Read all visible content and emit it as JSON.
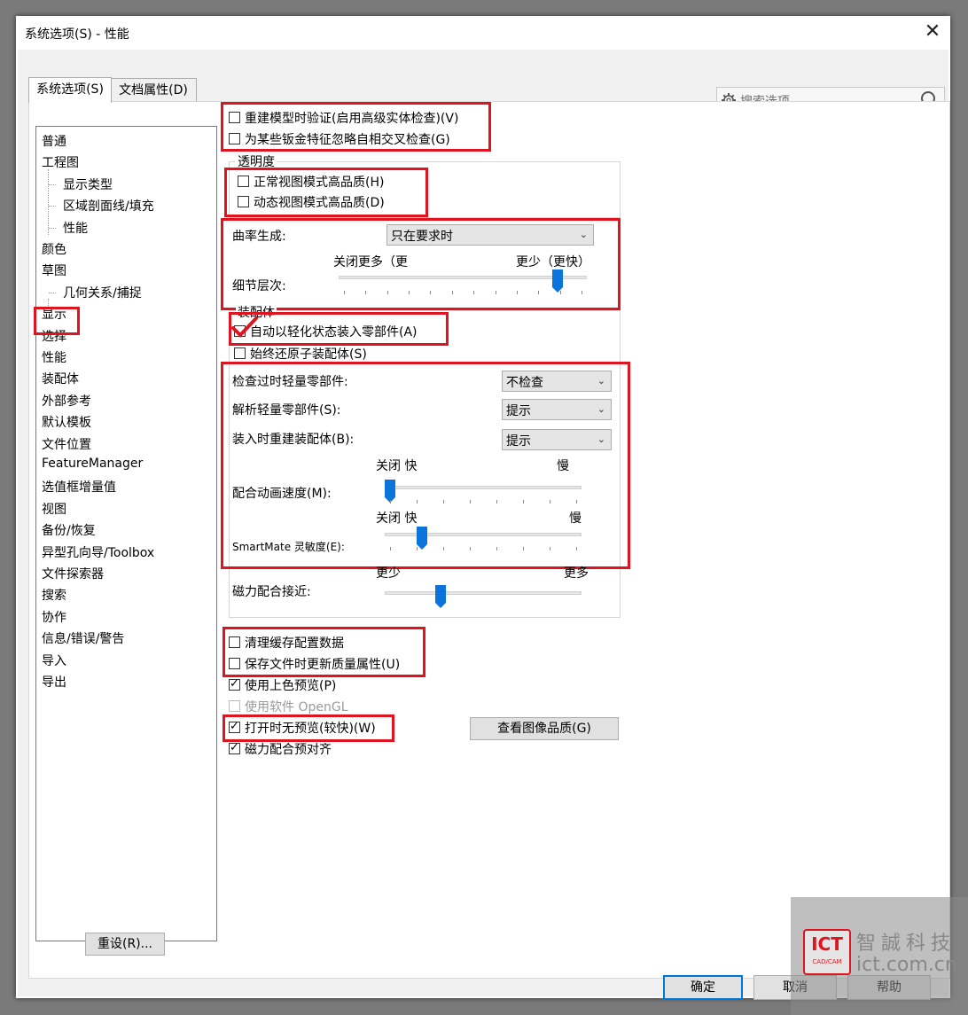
{
  "window": {
    "title": "系统选项(S) - 性能",
    "close": "✕"
  },
  "tabs": [
    {
      "label": "系统选项(S)",
      "active": true
    },
    {
      "label": "文档属性(D)",
      "active": false
    }
  ],
  "search": {
    "placeholder": "搜索选项",
    "icon": "gear-icon",
    "search_icon": "magnifier-icon"
  },
  "tree": [
    {
      "label": "普通"
    },
    {
      "label": "工程图"
    },
    {
      "label": "显示类型",
      "child": true
    },
    {
      "label": "区域剖面线/填充",
      "child": true
    },
    {
      "label": "性能",
      "child": true
    },
    {
      "label": "颜色"
    },
    {
      "label": "草图"
    },
    {
      "label": "几何关系/捕捉",
      "child": true
    },
    {
      "label": "显示"
    },
    {
      "label": "选择"
    },
    {
      "label": "性能",
      "selected": true
    },
    {
      "label": "装配体"
    },
    {
      "label": "外部参考"
    },
    {
      "label": "默认模板"
    },
    {
      "label": "文件位置"
    },
    {
      "label": "FeatureManager"
    },
    {
      "label": "选值框增量值"
    },
    {
      "label": "视图"
    },
    {
      "label": "备份/恢复"
    },
    {
      "label": "异型孔向导/Toolbox"
    },
    {
      "label": "文件探索器"
    },
    {
      "label": "搜索"
    },
    {
      "label": "协作"
    },
    {
      "label": "信息/错误/警告"
    },
    {
      "label": "导入"
    },
    {
      "label": "导出"
    }
  ],
  "top_checks": [
    {
      "label": "重建模型时验证(启用高级实体检查)(V)",
      "checked": false
    },
    {
      "label": "为某些钣金特征忽略自相交叉检查(G)",
      "checked": false
    }
  ],
  "transparency": {
    "legend": "透明度",
    "checks": [
      {
        "label": "正常视图模式高品质(H)",
        "checked": false
      },
      {
        "label": "动态视图模式高品质(D)",
        "checked": false
      }
    ]
  },
  "curvature": {
    "label": "曲率生成:",
    "value": "只在要求时",
    "detail_label": "细节层次:",
    "left_caption": "关闭更多（更",
    "right_caption": "更少（更快）",
    "level": 0.9
  },
  "assembly": {
    "legend": "装配体",
    "checks": [
      {
        "label": "自动以轻化状态装入零部件(A)",
        "checked": false
      },
      {
        "label": "始终还原子装配体(S)",
        "checked": false
      }
    ],
    "rows": [
      {
        "label": "检查过时轻量零部件:",
        "value": "不检查"
      },
      {
        "label": "解析轻量零部件(S):",
        "value": "提示"
      },
      {
        "label": "装入时重建装配体(B):",
        "value": "提示"
      }
    ],
    "mate_anim": {
      "label": "配合动画速度(M):",
      "left": "关闭 快",
      "right": "慢",
      "level": 0.0
    },
    "smartmate": {
      "label": "SmartMate 灵敏度(E):",
      "left": "关闭 快",
      "right": "慢",
      "level": 0.17
    },
    "magnetic": {
      "label": "磁力配合接近:",
      "left": "更少",
      "right": "更多",
      "level": 0.27
    }
  },
  "bottom_checks": [
    {
      "label": "清理缓存配置数据",
      "checked": false
    },
    {
      "label": "保存文件时更新质量属性(U)",
      "checked": false
    },
    {
      "label": "使用上色预览(P)",
      "checked": true
    },
    {
      "label": "使用软件 OpenGL",
      "checked": false,
      "disabled": true
    },
    {
      "label": "打开时无预览(较快)(W)",
      "checked": true
    },
    {
      "label": "磁力配合预对齐",
      "checked": true
    }
  ],
  "buttons": {
    "image_quality": "查看图像品质(G)",
    "reset": "重设(R)...",
    "ok": "确定",
    "cancel": "取消",
    "help": "帮助"
  },
  "watermark": {
    "logo": "ICT",
    "logo_sub": "CAD/CAM",
    "name": "智誠科技",
    "url": "ict.com.cn"
  },
  "colors": {
    "highlight": "#e0141e",
    "accent": "#0a74da"
  }
}
